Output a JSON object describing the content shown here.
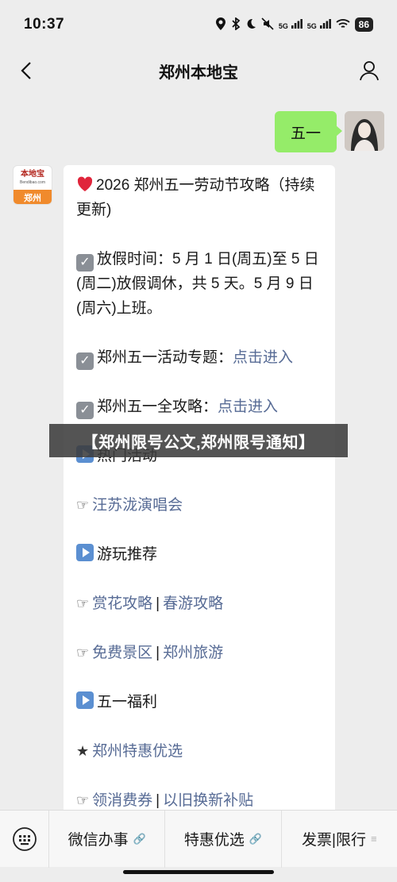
{
  "status_bar": {
    "time": "10:37",
    "signal_labels": [
      "5G",
      "5G"
    ],
    "battery": "86"
  },
  "nav": {
    "title": "郑州本地宝"
  },
  "chat": {
    "outgoing_text": "五一",
    "bot_avatar": {
      "brand": "本地宝",
      "site": "Bendibao.com",
      "city": "郑州"
    },
    "incoming": {
      "title": "2026 郑州五一劳动节攻略（持续更新)",
      "holiday_line": "放假时间：5 月 1 日(周五)至 5 日(周二)放假调休，共 5 天。5 月 9 日(周六)上班。",
      "topic_label": "郑州五一活动专题：",
      "topic_link": "点击进入",
      "guide_label": "郑州五一全攻略：",
      "guide_link": "点击进入",
      "section_hot": "热门活动",
      "hot_link": "汪苏泷演唱会",
      "section_play": "游玩推荐",
      "play_link_1": "赏花攻略",
      "play_link_2": "春游攻略",
      "play_link_3": "免费景区",
      "play_link_4": "郑州旅游",
      "section_welfare": "五一福利",
      "welfare_link_1": "郑州特惠优选",
      "welfare_link_2": "领消费券",
      "welfare_link_3": "以旧换新补贴",
      "separator": "|",
      "star": "★",
      "hand": "☞"
    }
  },
  "banner": {
    "text": "【郑州限号公文,郑州限号通知】"
  },
  "bottom_menu": {
    "items": [
      "微信办事",
      "特惠优选",
      "发票|限行"
    ]
  },
  "colors": {
    "bubble_out": "#95ec69",
    "link": "#576b95",
    "background": "#ededed"
  }
}
